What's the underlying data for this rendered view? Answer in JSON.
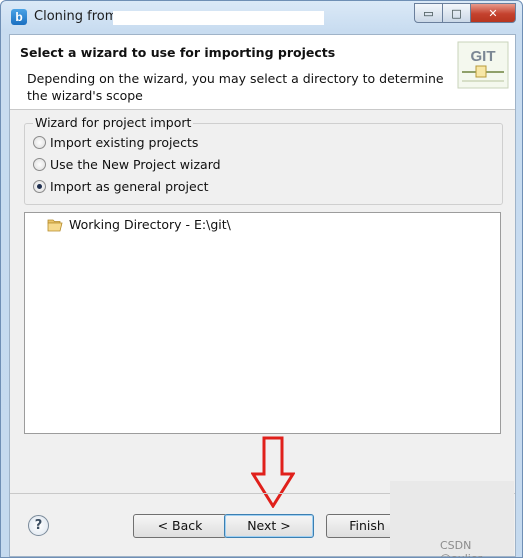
{
  "window": {
    "title": "Cloning from"
  },
  "window_controls": {
    "minimize": "▭",
    "maximize": "□",
    "close": "✕"
  },
  "app_icon": {
    "letter": "b",
    "icon": "eclipse-app-icon"
  },
  "header": {
    "title": "Select a wizard to use for importing projects",
    "description": "Depending on the wizard, you may select a directory to determine the wizard's scope",
    "logo_text": "GIT"
  },
  "wizard_group": {
    "legend": "Wizard for project import",
    "options": [
      {
        "label": "Import existing projects",
        "checked": false
      },
      {
        "label": "Use the New Project wizard",
        "checked": false
      },
      {
        "label": "Import as general project",
        "checked": true
      }
    ]
  },
  "tree": {
    "items": [
      {
        "label": "Working Directory - E:\\git\\",
        "icon": "folder-icon"
      }
    ]
  },
  "buttons": {
    "help": "?",
    "back": "< Back",
    "next": "Next >",
    "finish": "Finish"
  },
  "watermark": "CSDN @oulier",
  "colors": {
    "arrow": "#e0201b",
    "close_button": "#c4422e"
  }
}
